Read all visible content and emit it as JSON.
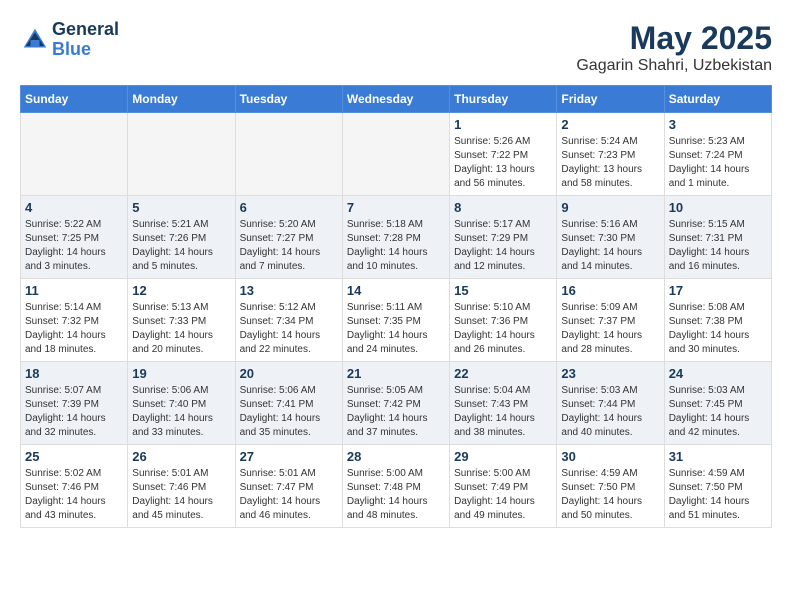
{
  "header": {
    "logo_line1": "General",
    "logo_line2": "Blue",
    "title": "May 2025",
    "subtitle": "Gagarin Shahri, Uzbekistan"
  },
  "calendar": {
    "days_of_week": [
      "Sunday",
      "Monday",
      "Tuesday",
      "Wednesday",
      "Thursday",
      "Friday",
      "Saturday"
    ],
    "weeks": [
      [
        {
          "day": "",
          "empty": true
        },
        {
          "day": "",
          "empty": true
        },
        {
          "day": "",
          "empty": true
        },
        {
          "day": "",
          "empty": true
        },
        {
          "day": "1",
          "sunrise": "5:26 AM",
          "sunset": "7:22 PM",
          "daylight": "13 hours and 56 minutes."
        },
        {
          "day": "2",
          "sunrise": "5:24 AM",
          "sunset": "7:23 PM",
          "daylight": "13 hours and 58 minutes."
        },
        {
          "day": "3",
          "sunrise": "5:23 AM",
          "sunset": "7:24 PM",
          "daylight": "14 hours and 1 minute."
        }
      ],
      [
        {
          "day": "4",
          "sunrise": "5:22 AM",
          "sunset": "7:25 PM",
          "daylight": "14 hours and 3 minutes."
        },
        {
          "day": "5",
          "sunrise": "5:21 AM",
          "sunset": "7:26 PM",
          "daylight": "14 hours and 5 minutes."
        },
        {
          "day": "6",
          "sunrise": "5:20 AM",
          "sunset": "7:27 PM",
          "daylight": "14 hours and 7 minutes."
        },
        {
          "day": "7",
          "sunrise": "5:18 AM",
          "sunset": "7:28 PM",
          "daylight": "14 hours and 10 minutes."
        },
        {
          "day": "8",
          "sunrise": "5:17 AM",
          "sunset": "7:29 PM",
          "daylight": "14 hours and 12 minutes."
        },
        {
          "day": "9",
          "sunrise": "5:16 AM",
          "sunset": "7:30 PM",
          "daylight": "14 hours and 14 minutes."
        },
        {
          "day": "10",
          "sunrise": "5:15 AM",
          "sunset": "7:31 PM",
          "daylight": "14 hours and 16 minutes."
        }
      ],
      [
        {
          "day": "11",
          "sunrise": "5:14 AM",
          "sunset": "7:32 PM",
          "daylight": "14 hours and 18 minutes."
        },
        {
          "day": "12",
          "sunrise": "5:13 AM",
          "sunset": "7:33 PM",
          "daylight": "14 hours and 20 minutes."
        },
        {
          "day": "13",
          "sunrise": "5:12 AM",
          "sunset": "7:34 PM",
          "daylight": "14 hours and 22 minutes."
        },
        {
          "day": "14",
          "sunrise": "5:11 AM",
          "sunset": "7:35 PM",
          "daylight": "14 hours and 24 minutes."
        },
        {
          "day": "15",
          "sunrise": "5:10 AM",
          "sunset": "7:36 PM",
          "daylight": "14 hours and 26 minutes."
        },
        {
          "day": "16",
          "sunrise": "5:09 AM",
          "sunset": "7:37 PM",
          "daylight": "14 hours and 28 minutes."
        },
        {
          "day": "17",
          "sunrise": "5:08 AM",
          "sunset": "7:38 PM",
          "daylight": "14 hours and 30 minutes."
        }
      ],
      [
        {
          "day": "18",
          "sunrise": "5:07 AM",
          "sunset": "7:39 PM",
          "daylight": "14 hours and 32 minutes."
        },
        {
          "day": "19",
          "sunrise": "5:06 AM",
          "sunset": "7:40 PM",
          "daylight": "14 hours and 33 minutes."
        },
        {
          "day": "20",
          "sunrise": "5:06 AM",
          "sunset": "7:41 PM",
          "daylight": "14 hours and 35 minutes."
        },
        {
          "day": "21",
          "sunrise": "5:05 AM",
          "sunset": "7:42 PM",
          "daylight": "14 hours and 37 minutes."
        },
        {
          "day": "22",
          "sunrise": "5:04 AM",
          "sunset": "7:43 PM",
          "daylight": "14 hours and 38 minutes."
        },
        {
          "day": "23",
          "sunrise": "5:03 AM",
          "sunset": "7:44 PM",
          "daylight": "14 hours and 40 minutes."
        },
        {
          "day": "24",
          "sunrise": "5:03 AM",
          "sunset": "7:45 PM",
          "daylight": "14 hours and 42 minutes."
        }
      ],
      [
        {
          "day": "25",
          "sunrise": "5:02 AM",
          "sunset": "7:46 PM",
          "daylight": "14 hours and 43 minutes."
        },
        {
          "day": "26",
          "sunrise": "5:01 AM",
          "sunset": "7:46 PM",
          "daylight": "14 hours and 45 minutes."
        },
        {
          "day": "27",
          "sunrise": "5:01 AM",
          "sunset": "7:47 PM",
          "daylight": "14 hours and 46 minutes."
        },
        {
          "day": "28",
          "sunrise": "5:00 AM",
          "sunset": "7:48 PM",
          "daylight": "14 hours and 48 minutes."
        },
        {
          "day": "29",
          "sunrise": "5:00 AM",
          "sunset": "7:49 PM",
          "daylight": "14 hours and 49 minutes."
        },
        {
          "day": "30",
          "sunrise": "4:59 AM",
          "sunset": "7:50 PM",
          "daylight": "14 hours and 50 minutes."
        },
        {
          "day": "31",
          "sunrise": "4:59 AM",
          "sunset": "7:50 PM",
          "daylight": "14 hours and 51 minutes."
        }
      ]
    ]
  }
}
